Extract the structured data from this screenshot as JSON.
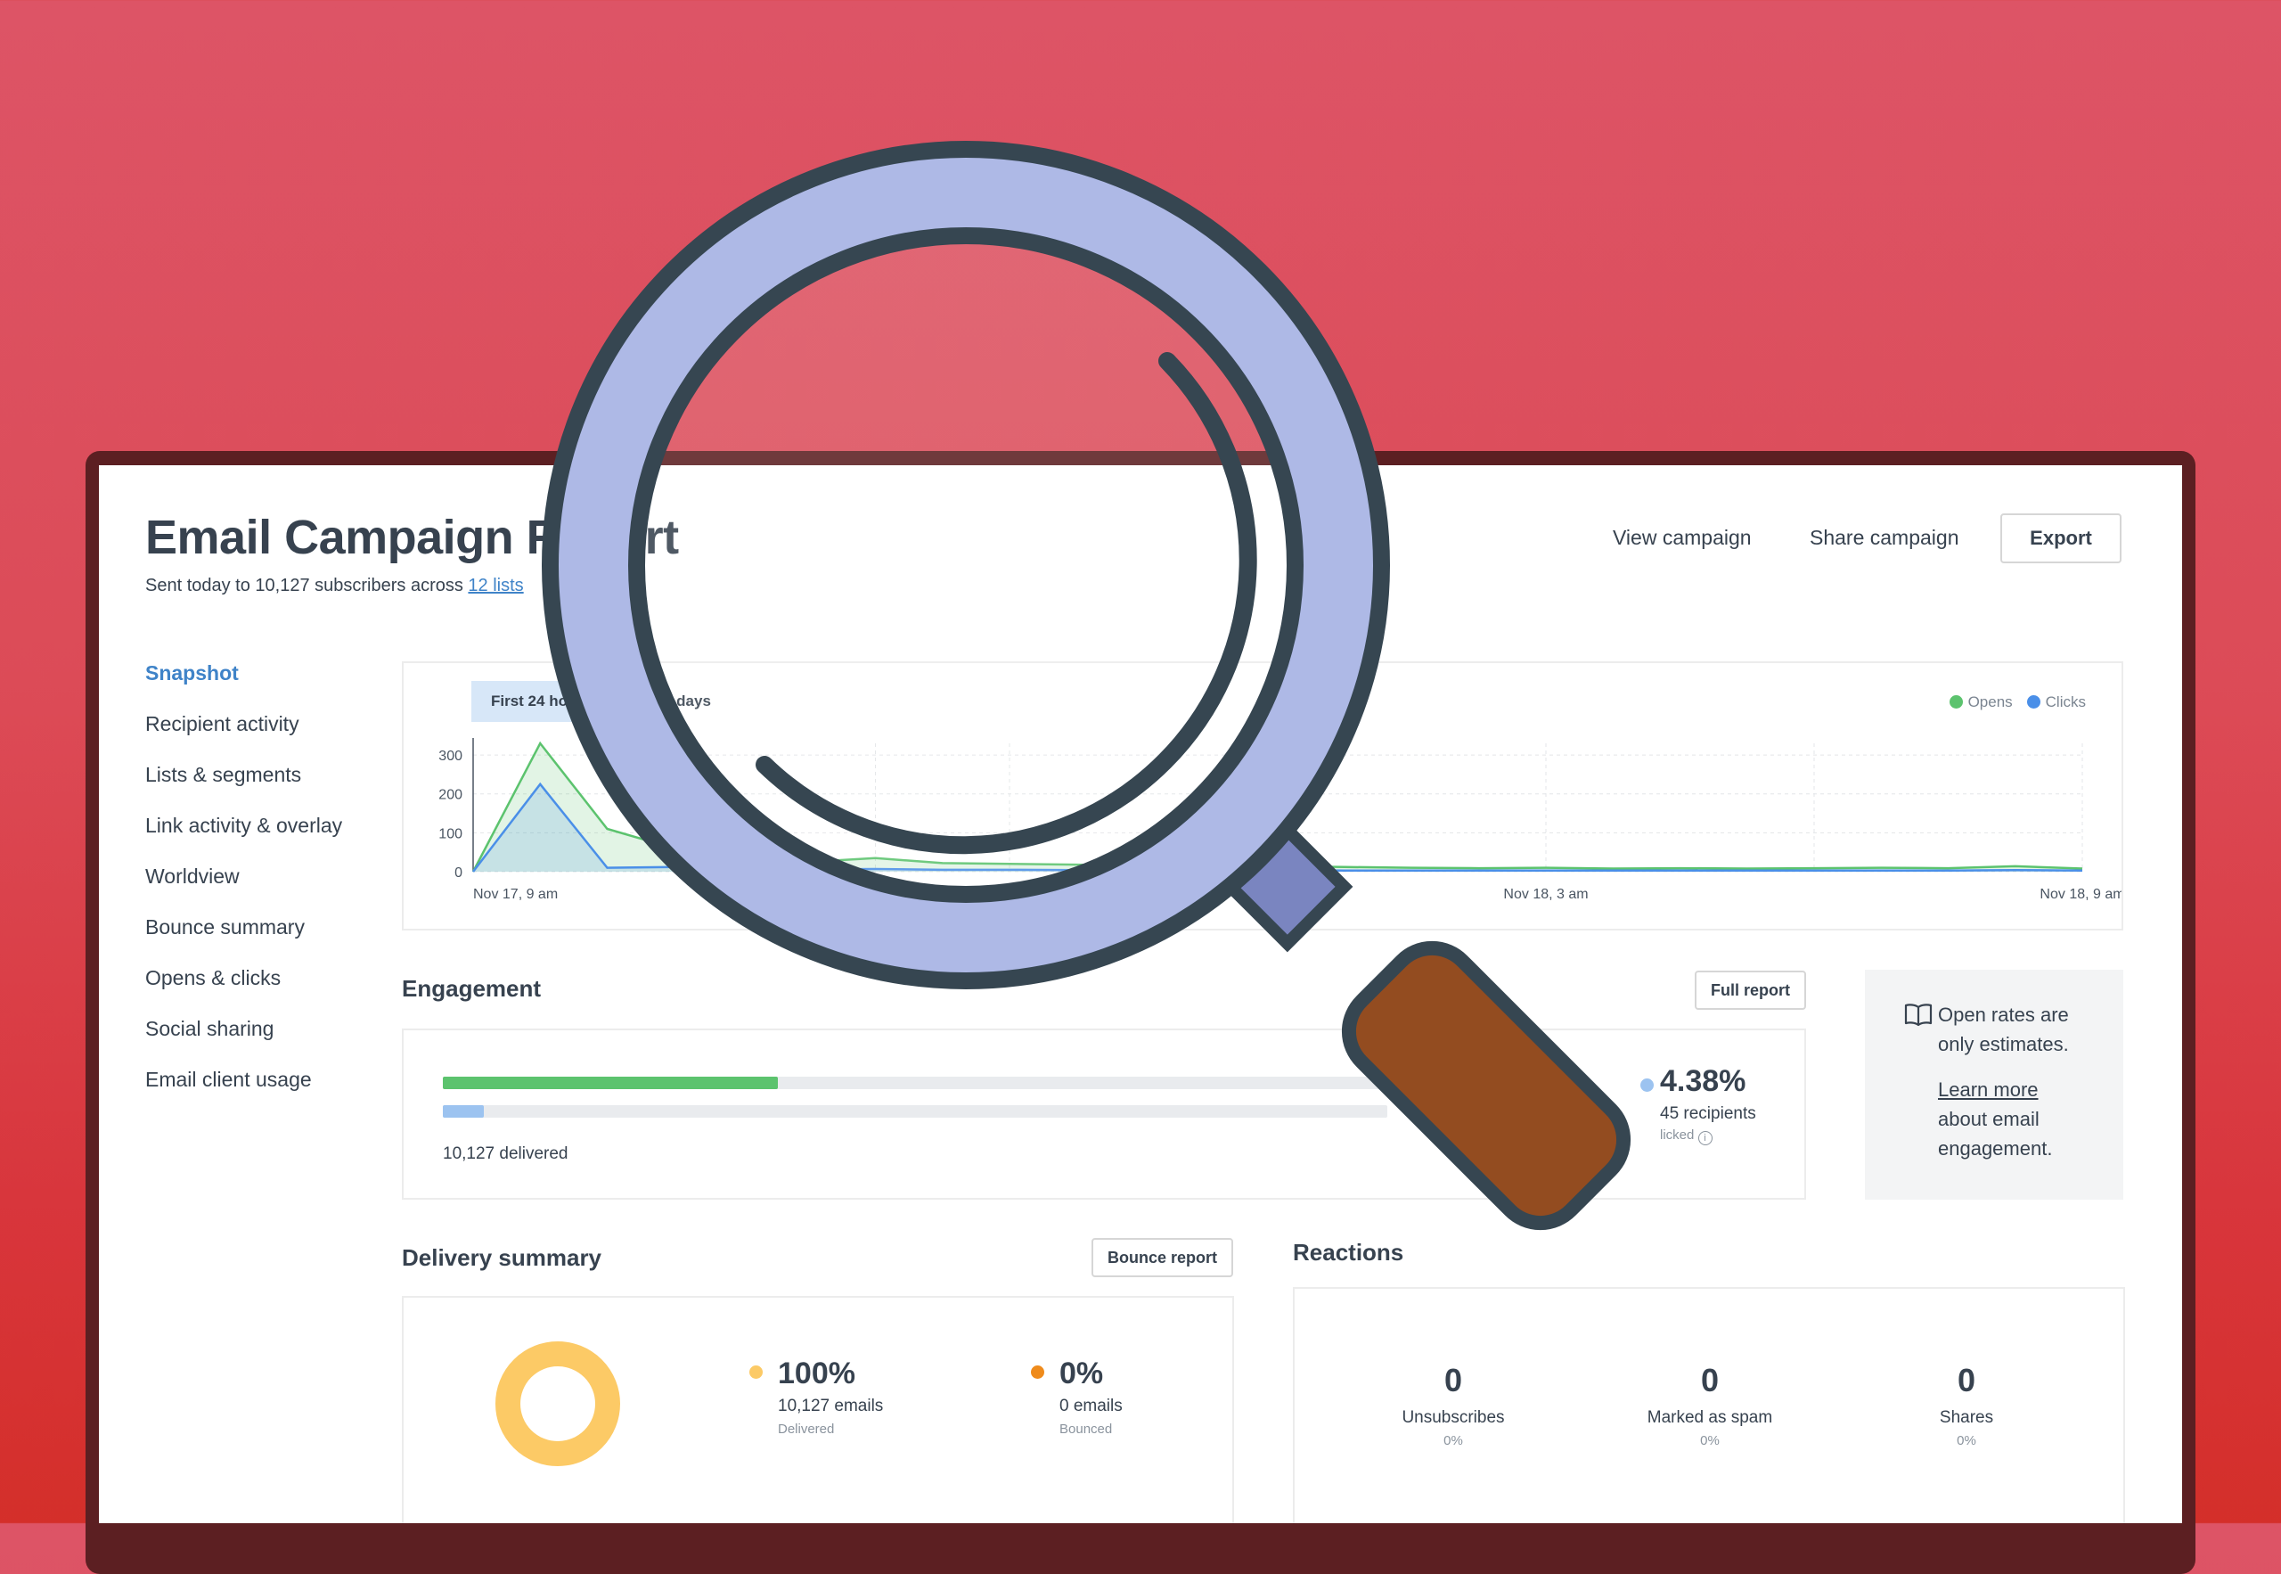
{
  "header": {
    "title": "Email Campaign Report",
    "subtitle_prefix": "Sent today to 10,127 subscribers across ",
    "lists_link": "12 lists",
    "view_campaign": "View campaign",
    "share_campaign": "Share campaign",
    "export": "Export"
  },
  "sidebar": {
    "items": [
      {
        "label": "Snapshot",
        "active": true
      },
      {
        "label": "Recipient activity"
      },
      {
        "label": "Lists & segments"
      },
      {
        "label": "Link activity & overlay"
      },
      {
        "label": "Worldview"
      },
      {
        "label": "Bounce summary"
      },
      {
        "label": "Opens & clicks"
      },
      {
        "label": "Social sharing"
      },
      {
        "label": "Email client usage"
      }
    ]
  },
  "chart": {
    "tabs": [
      "First 24 hou",
      "7 days"
    ],
    "legend": [
      {
        "label": "Opens",
        "color": "#5cc36e"
      },
      {
        "label": "Clicks",
        "color": "#4a8fe8"
      }
    ]
  },
  "chart_data": {
    "type": "area",
    "title": "",
    "xlabel": "",
    "ylabel": "",
    "ylim": [
      0,
      330
    ],
    "y_ticks": [
      "300",
      "200",
      "100",
      "0"
    ],
    "x_ticks": [
      "Nov 17, 9 am",
      "Nov 18, 3 am",
      "Nov 18, 9 am"
    ],
    "grid": true,
    "legend_position": "top-right",
    "series": [
      {
        "name": "Opens",
        "color": "#5cc36e",
        "x": [
          0,
          1,
          2,
          3,
          4,
          5,
          6,
          7,
          8,
          9,
          10,
          11,
          12,
          13,
          14,
          15,
          16,
          17,
          18,
          19,
          20,
          21,
          22,
          23,
          24
        ],
        "values": [
          0,
          330,
          110,
          60,
          30,
          25,
          35,
          22,
          20,
          18,
          15,
          12,
          14,
          12,
          10,
          9,
          10,
          8,
          9,
          8,
          9,
          10,
          9,
          14,
          8
        ]
      },
      {
        "name": "Clicks",
        "color": "#4a8fe8",
        "x": [
          0,
          1,
          2,
          3,
          4,
          5,
          6,
          7,
          8,
          9,
          10,
          11,
          12,
          13,
          14,
          15,
          16,
          17,
          18,
          19,
          20,
          21,
          22,
          23,
          24
        ],
        "values": [
          0,
          225,
          10,
          12,
          8,
          6,
          7,
          5,
          5,
          4,
          4,
          3,
          4,
          3,
          3,
          3,
          3,
          3,
          3,
          3,
          3,
          3,
          3,
          4,
          3
        ]
      }
    ]
  },
  "engagement": {
    "heading": "Engagement",
    "full_report": "Full report",
    "open_fraction": 0.355,
    "click_fraction": 0.0438,
    "delivered": "10,127 delivered",
    "click_pct": "4.38%",
    "click_recipients": "45 recipients",
    "click_label": "licked",
    "click_color": "#9cc3f0",
    "open_color": "#5cc36e",
    "info": {
      "line1": "Open rates are",
      "line2": "only estimates.",
      "learn_more": "Learn more",
      "line3": "about email",
      "line4": "engagement."
    }
  },
  "delivery": {
    "heading": "Delivery summary",
    "bounce_report": "Bounce report",
    "delivered_pct": "100%",
    "delivered_emails": "10,127 emails",
    "delivered_label": "Delivered",
    "delivered_color": "#fcca66",
    "bounced_pct": "0%",
    "bounced_emails": "0 emails",
    "bounced_label": "Bounced",
    "bounced_color": "#ef8b1c",
    "delivered_fraction": 1.0
  },
  "reactions": {
    "heading": "Reactions",
    "items": [
      {
        "value": "0",
        "label": "Unsubscribes",
        "pct": "0%"
      },
      {
        "value": "0",
        "label": "Marked as spam",
        "pct": "0%"
      },
      {
        "value": "0",
        "label": "Shares",
        "pct": "0%"
      }
    ]
  },
  "colors": {
    "accent": "#3f83c8",
    "background": "#dc4b57",
    "magnifier_rim": "#aeb9e6",
    "magnifier_handle": "#934c20",
    "magnifier_outline": "#364651"
  }
}
